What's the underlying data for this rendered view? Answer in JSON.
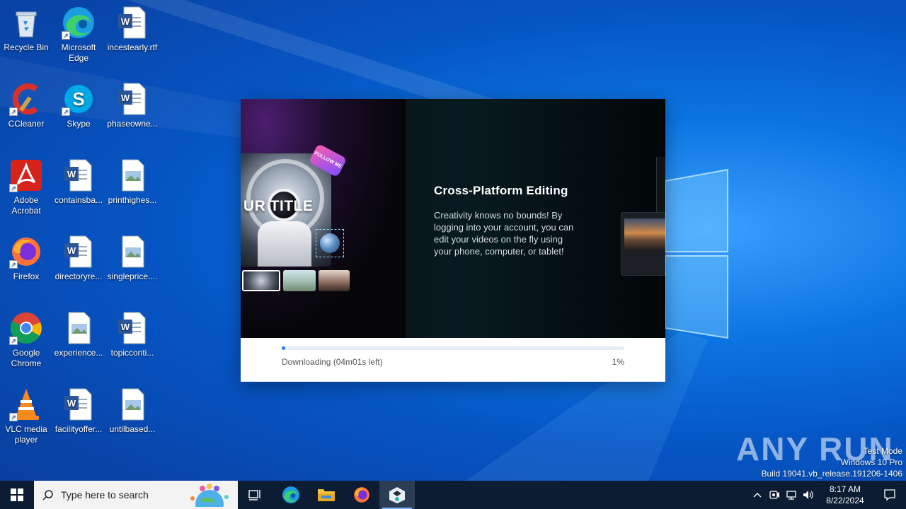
{
  "desktop": {
    "icons": [
      {
        "label": "Recycle Bin"
      },
      {
        "label": "Microsoft Edge"
      },
      {
        "label": "incestearly.rtf"
      },
      {
        "label": "CCleaner"
      },
      {
        "label": "Skype"
      },
      {
        "label": "phaseowne..."
      },
      {
        "label": "Adobe Acrobat"
      },
      {
        "label": "containsba..."
      },
      {
        "label": "printhighes..."
      },
      {
        "label": "Firefox"
      },
      {
        "label": "directoryre..."
      },
      {
        "label": "singleprice...."
      },
      {
        "label": "Google Chrome"
      },
      {
        "label": "experience..."
      },
      {
        "label": "topicconti..."
      },
      {
        "label": "VLC media player"
      },
      {
        "label": "facilityoffer..."
      },
      {
        "label": "untilbased..."
      }
    ]
  },
  "installer": {
    "hero": {
      "title": "Cross-Platform Editing",
      "body": "Creativity knows no bounds! By logging into your account, you can edit your videos on the fly using your phone, computer, or tablet!",
      "mock_title": "UR TITLE",
      "follow_badge": "FOLLOW ME"
    },
    "progress": {
      "status": "Downloading (04m01s left)",
      "percent_label": "1%",
      "fraction": 0.01
    }
  },
  "watermark": "ANY RUN",
  "system": {
    "line1": "Test Mode",
    "line2": "Windows 10 Pro",
    "line3": "Build 19041.vb_release.191206-1406"
  },
  "taskbar": {
    "search_placeholder": "Type here to search",
    "time": "8:17 AM",
    "date": "8/22/2024"
  },
  "colors": {
    "accent": "#2a7de1",
    "taskbar": "#0b1c33"
  }
}
